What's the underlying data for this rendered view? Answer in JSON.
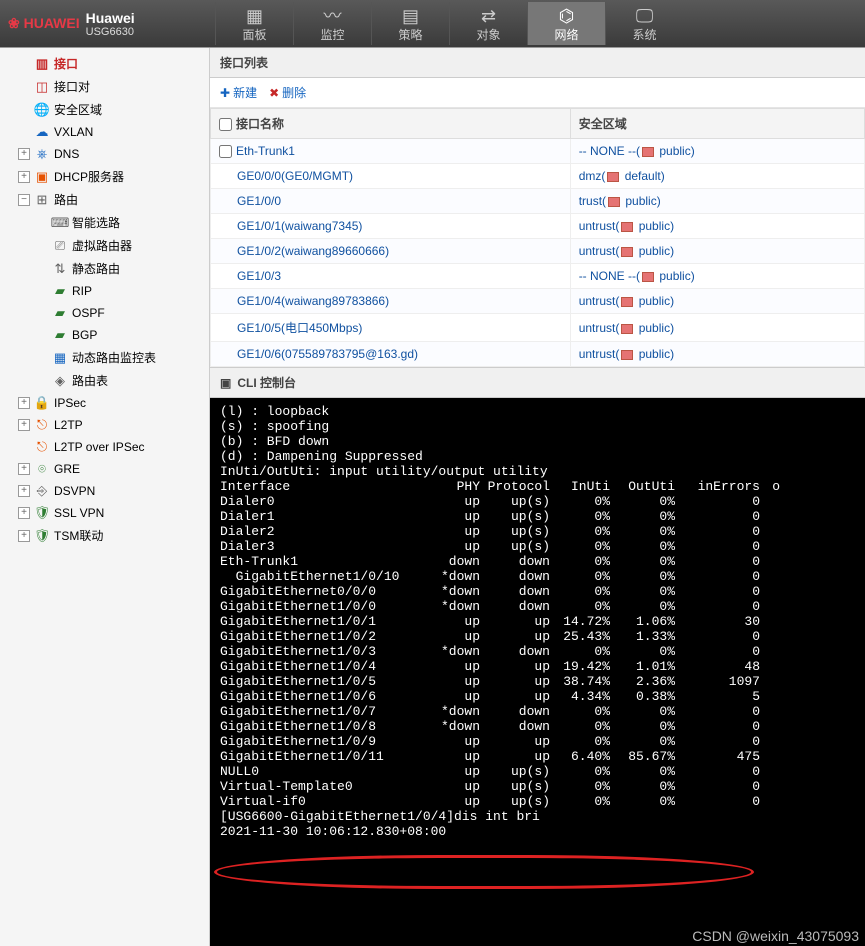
{
  "brand": "Huawei",
  "model": "USG6630",
  "topnav": [
    {
      "label": "面板",
      "icon": "▦"
    },
    {
      "label": "监控",
      "icon": "〰"
    },
    {
      "label": "策略",
      "icon": "▤"
    },
    {
      "label": "对象",
      "icon": "⇄"
    },
    {
      "label": "网络",
      "icon": "⌬",
      "active": true
    },
    {
      "label": "系统",
      "icon": "🖵"
    }
  ],
  "sidebar": [
    {
      "label": "接口",
      "icon": "▥",
      "color": "i-red",
      "level": 1,
      "selected": true
    },
    {
      "label": "接口对",
      "icon": "◫",
      "color": "i-red",
      "level": 1
    },
    {
      "label": "安全区域",
      "icon": "🌐",
      "color": "i-blue",
      "level": 1
    },
    {
      "label": "VXLAN",
      "icon": "☁",
      "color": "i-blue",
      "level": 1
    },
    {
      "label": "DNS",
      "icon": "⎈",
      "color": "i-blue",
      "level": 1,
      "expander": "+"
    },
    {
      "label": "DHCP服务器",
      "icon": "▣",
      "color": "i-orange",
      "level": 1,
      "expander": "+"
    },
    {
      "label": "路由",
      "icon": "⊞",
      "color": "i-gray",
      "level": 1,
      "expander": "−"
    },
    {
      "label": "智能选路",
      "icon": "⌨",
      "color": "i-gray",
      "level": 2
    },
    {
      "label": "虚拟路由器",
      "icon": "⎚",
      "color": "i-gray",
      "level": 2
    },
    {
      "label": "静态路由",
      "icon": "⇅",
      "color": "i-gray",
      "level": 2
    },
    {
      "label": "RIP",
      "icon": "▰",
      "color": "i-green",
      "level": 2
    },
    {
      "label": "OSPF",
      "icon": "▰",
      "color": "i-green",
      "level": 2
    },
    {
      "label": "BGP",
      "icon": "▰",
      "color": "i-green",
      "level": 2
    },
    {
      "label": "动态路由监控表",
      "icon": "▦",
      "color": "i-blue",
      "level": 2
    },
    {
      "label": "路由表",
      "icon": "◈",
      "color": "i-gray",
      "level": 2
    },
    {
      "label": "IPSec",
      "icon": "🔒",
      "color": "i-orange",
      "level": 1,
      "expander": "+"
    },
    {
      "label": "L2TP",
      "icon": "⎋",
      "color": "i-orange",
      "level": 1,
      "expander": "+"
    },
    {
      "label": "L2TP over IPSec",
      "icon": "⎋",
      "color": "i-orange",
      "level": 1
    },
    {
      "label": "GRE",
      "icon": "⌾",
      "color": "i-green",
      "level": 1,
      "expander": "+"
    },
    {
      "label": "DSVPN",
      "icon": "⎆",
      "color": "i-gray",
      "level": 1,
      "expander": "+"
    },
    {
      "label": "SSL VPN",
      "icon": "🛡",
      "color": "i-green",
      "level": 1,
      "expander": "+"
    },
    {
      "label": "TSM联动",
      "icon": "🛡",
      "color": "i-green",
      "level": 1,
      "expander": "+"
    }
  ],
  "panel": {
    "title": "接口列表",
    "new_btn": "新建",
    "delete_btn": "删除",
    "cols": {
      "name": "接口名称",
      "zone": "安全区域"
    }
  },
  "rows": [
    {
      "name": "Eth-Trunk1",
      "zone_prefix": "-- NONE --(",
      "zone": "public)",
      "checkable": true
    },
    {
      "name": "GE0/0/0(GE0/MGMT)",
      "zone_prefix": "dmz(",
      "zone": "default)"
    },
    {
      "name": "GE1/0/0",
      "zone_prefix": "trust(",
      "zone": "public)"
    },
    {
      "name": "GE1/0/1(waiwang7345)",
      "zone_prefix": "untrust(",
      "zone": "public)"
    },
    {
      "name": "GE1/0/2(waiwang89660666)",
      "zone_prefix": "untrust(",
      "zone": "public)"
    },
    {
      "name": "GE1/0/3",
      "zone_prefix": "-- NONE --(",
      "zone": "public)"
    },
    {
      "name": "GE1/0/4(waiwang89783866)",
      "zone_prefix": "untrust(",
      "zone": "public)"
    },
    {
      "name": "GE1/0/5(电口450Mbps)",
      "zone_prefix": "untrust(",
      "zone": "public)"
    },
    {
      "name": "GE1/0/6(075589783795@163.gd)",
      "zone_prefix": "untrust(",
      "zone": "public)"
    }
  ],
  "cli": {
    "title": "CLI 控制台",
    "legend": [
      "(l) : loopback",
      "(s) : spoofing",
      "(b) : BFD down",
      "(d) : Dampening Suppressed",
      "InUti/OutUti: input utility/output utility"
    ],
    "header": [
      "Interface",
      "PHY",
      "Protocol",
      "InUti",
      "OutUti",
      "inErrors",
      "o"
    ],
    "data": [
      [
        "Dialer0",
        "up",
        "up(s)",
        "0%",
        "0%",
        "0",
        ""
      ],
      [
        "Dialer1",
        "up",
        "up(s)",
        "0%",
        "0%",
        "0",
        ""
      ],
      [
        "Dialer2",
        "up",
        "up(s)",
        "0%",
        "0%",
        "0",
        ""
      ],
      [
        "Dialer3",
        "up",
        "up(s)",
        "0%",
        "0%",
        "0",
        ""
      ],
      [
        "Eth-Trunk1",
        "down",
        "down",
        "0%",
        "0%",
        "0",
        ""
      ],
      [
        "  GigabitEthernet1/0/10",
        "*down",
        "down",
        "0%",
        "0%",
        "0",
        ""
      ],
      [
        "GigabitEthernet0/0/0",
        "*down",
        "down",
        "0%",
        "0%",
        "0",
        ""
      ],
      [
        "GigabitEthernet1/0/0",
        "*down",
        "down",
        "0%",
        "0%",
        "0",
        ""
      ],
      [
        "GigabitEthernet1/0/1",
        "up",
        "up",
        "14.72%",
        "1.06%",
        "30",
        ""
      ],
      [
        "GigabitEthernet1/0/2",
        "up",
        "up",
        "25.43%",
        "1.33%",
        "0",
        ""
      ],
      [
        "GigabitEthernet1/0/3",
        "*down",
        "down",
        "0%",
        "0%",
        "0",
        ""
      ],
      [
        "GigabitEthernet1/0/4",
        "up",
        "up",
        "19.42%",
        "1.01%",
        "48",
        ""
      ],
      [
        "GigabitEthernet1/0/5",
        "up",
        "up",
        "38.74%",
        "2.36%",
        "1097",
        ""
      ],
      [
        "GigabitEthernet1/0/6",
        "up",
        "up",
        "4.34%",
        "0.38%",
        "5",
        ""
      ],
      [
        "GigabitEthernet1/0/7",
        "*down",
        "down",
        "0%",
        "0%",
        "0",
        ""
      ],
      [
        "GigabitEthernet1/0/8",
        "*down",
        "down",
        "0%",
        "0%",
        "0",
        ""
      ],
      [
        "GigabitEthernet1/0/9",
        "up",
        "up",
        "0%",
        "0%",
        "0",
        ""
      ],
      [
        "GigabitEthernet1/0/11",
        "up",
        "up",
        "6.40%",
        "85.67%",
        "475",
        ""
      ],
      [
        "NULL0",
        "up",
        "up(s)",
        "0%",
        "0%",
        "0",
        ""
      ],
      [
        "Virtual-Template0",
        "up",
        "up(s)",
        "0%",
        "0%",
        "0",
        ""
      ],
      [
        "Virtual-if0",
        "up",
        "up(s)",
        "0%",
        "0%",
        "0",
        ""
      ]
    ],
    "prompt": "[USG6600-GigabitEthernet1/0/4]dis int bri",
    "timestamp": "2021-11-30 10:06:12.830+08:00"
  },
  "watermark": "CSDN @weixin_43075093"
}
